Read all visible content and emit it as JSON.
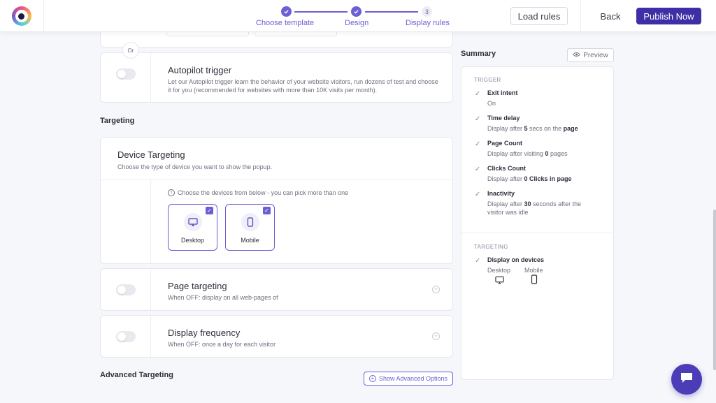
{
  "header": {
    "steps": [
      {
        "label": "Choose template",
        "state": "done"
      },
      {
        "label": "Design",
        "state": "done"
      },
      {
        "label": "Display rules",
        "number": "3",
        "state": "current"
      }
    ],
    "load_rules": "Load rules",
    "back": "Back",
    "publish": "Publish Now"
  },
  "main": {
    "or_label": "Or",
    "autopilot": {
      "title": "Autopilot trigger",
      "description": "Let our Autopilot trigger learn the behavior of your website visitors, run dozens of test and choose it for you (recommended for websites with more than 10K visits per month)."
    },
    "targeting_title": "Targeting",
    "device_targeting": {
      "title": "Device Targeting",
      "description": "Choose the type of device you want to show the popup.",
      "hint": "Choose the devices from below - you can pick more than one",
      "devices": [
        {
          "label": "Desktop",
          "checked": true
        },
        {
          "label": "Mobile",
          "checked": true
        }
      ]
    },
    "page_targeting": {
      "title": "Page targeting",
      "description": "When OFF: display on all web-pages of"
    },
    "display_frequency": {
      "title": "Display frequency",
      "description": "When OFF: once a day for each visitor"
    },
    "advanced_title": "Advanced Targeting",
    "show_advanced": "Show Advanced Options"
  },
  "summary": {
    "title": "Summary",
    "preview": "Preview",
    "trigger_label": "TRIGGER",
    "targeting_label": "TARGETING",
    "triggers": [
      {
        "name": "Exit intent",
        "d1": "On",
        "b1": "",
        "d2": "",
        "b2": "",
        "d3": ""
      },
      {
        "name": "Time delay",
        "d1": "Display after ",
        "b1": "5",
        "d2": " secs on the ",
        "b2": "page",
        "d3": ""
      },
      {
        "name": "Page Count",
        "d1": "Display after visiting ",
        "b1": "0",
        "d2": " pages",
        "b2": "",
        "d3": ""
      },
      {
        "name": "Clicks Count",
        "d1": "Display after ",
        "b1": "0 Clicks in page",
        "d2": "",
        "b2": "",
        "d3": ""
      },
      {
        "name": "Inactivity",
        "d1": "Display after ",
        "b1": "30",
        "d2": " seconds after the visitor was idle",
        "b2": "",
        "d3": ""
      }
    ],
    "targeting": {
      "name": "Display on devices",
      "devices": [
        "Desktop",
        "Mobile"
      ]
    }
  }
}
